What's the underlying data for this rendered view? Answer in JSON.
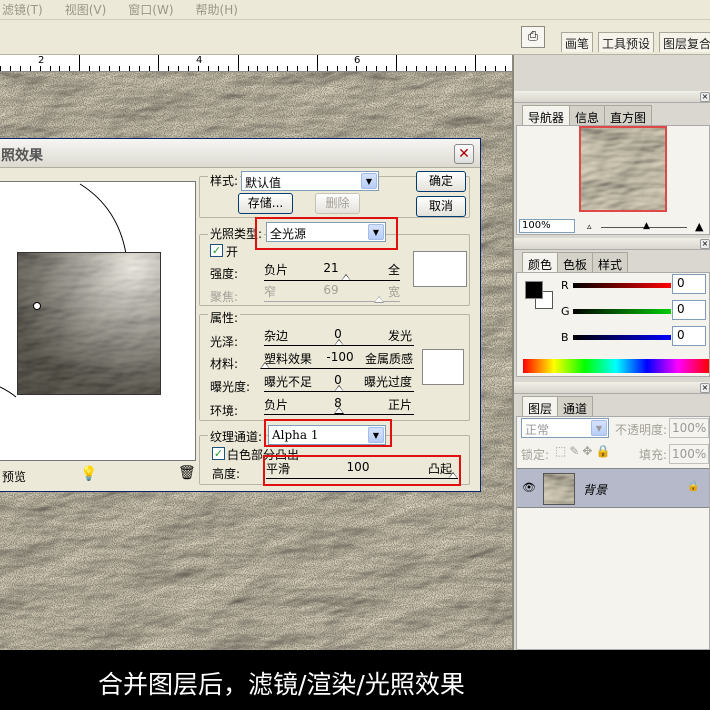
{
  "menubar": {
    "items": [
      "滤镜(T)",
      "视图(V)",
      "窗口(W)",
      "帮助(H)"
    ]
  },
  "palette_well": {
    "tabs": [
      "画笔",
      "工具预设",
      "图层复合"
    ]
  },
  "ruler": {
    "labels": [
      "2",
      "4",
      "6",
      "8",
      "9",
      "10"
    ]
  },
  "dialog": {
    "title": "照效果",
    "style_label": "样式:",
    "style_value": "默认值",
    "save_button": "存储...",
    "delete_button": "删除",
    "ok_button": "确定",
    "cancel_button": "取消",
    "light_type_label": "光照类型:",
    "light_type_value": "全光源",
    "on_label": "开",
    "intensity": {
      "label": "强度:",
      "min_label": "负片",
      "value": "21",
      "max_label": "全"
    },
    "focus": {
      "label": "聚焦:",
      "min_label": "窄",
      "value": "69",
      "max_label": "宽"
    },
    "properties_label": "属性:",
    "gloss": {
      "label": "光泽:",
      "min_label": "杂边",
      "value": "0",
      "max_label": "发光"
    },
    "material": {
      "label": "材料:",
      "min_label": "塑料效果",
      "value": "-100",
      "max_label": "金属质感"
    },
    "exposure": {
      "label": "曝光度:",
      "min_label": "曝光不足",
      "value": "0",
      "max_label": "曝光过度"
    },
    "ambience": {
      "label": "环境:",
      "min_label": "负片",
      "value": "8",
      "max_label": "正片"
    },
    "texture_label": "纹理通道:",
    "texture_value": "Alpha 1",
    "white_high_label": "白色部分凸出",
    "height": {
      "label": "高度:",
      "min_label": "平滑",
      "value": "100",
      "max_label": "凸起"
    },
    "preview_label": "预览"
  },
  "navigator": {
    "tabs": [
      "导航器",
      "信息",
      "直方图"
    ],
    "zoom": "100%"
  },
  "color_panel": {
    "tabs": [
      "颜色",
      "色板",
      "样式"
    ],
    "channels": [
      {
        "name": "R",
        "value": "0"
      },
      {
        "name": "G",
        "value": "0"
      },
      {
        "name": "B",
        "value": "0"
      }
    ]
  },
  "layers_panel": {
    "tabs": [
      "图层",
      "通道"
    ],
    "blend_mode": "正常",
    "opacity_label": "不透明度:",
    "opacity_value": "100%",
    "lock_label": "锁定:",
    "fill_label": "填充:",
    "fill_value": "100%",
    "layer_name": "背景"
  },
  "caption": "合并图层后，滤镜/渲染/光照效果",
  "colors": {
    "red_highlight": "#e01010",
    "panel_bg": "#d9d7cf",
    "dialog_bg": "#ece9d8"
  }
}
